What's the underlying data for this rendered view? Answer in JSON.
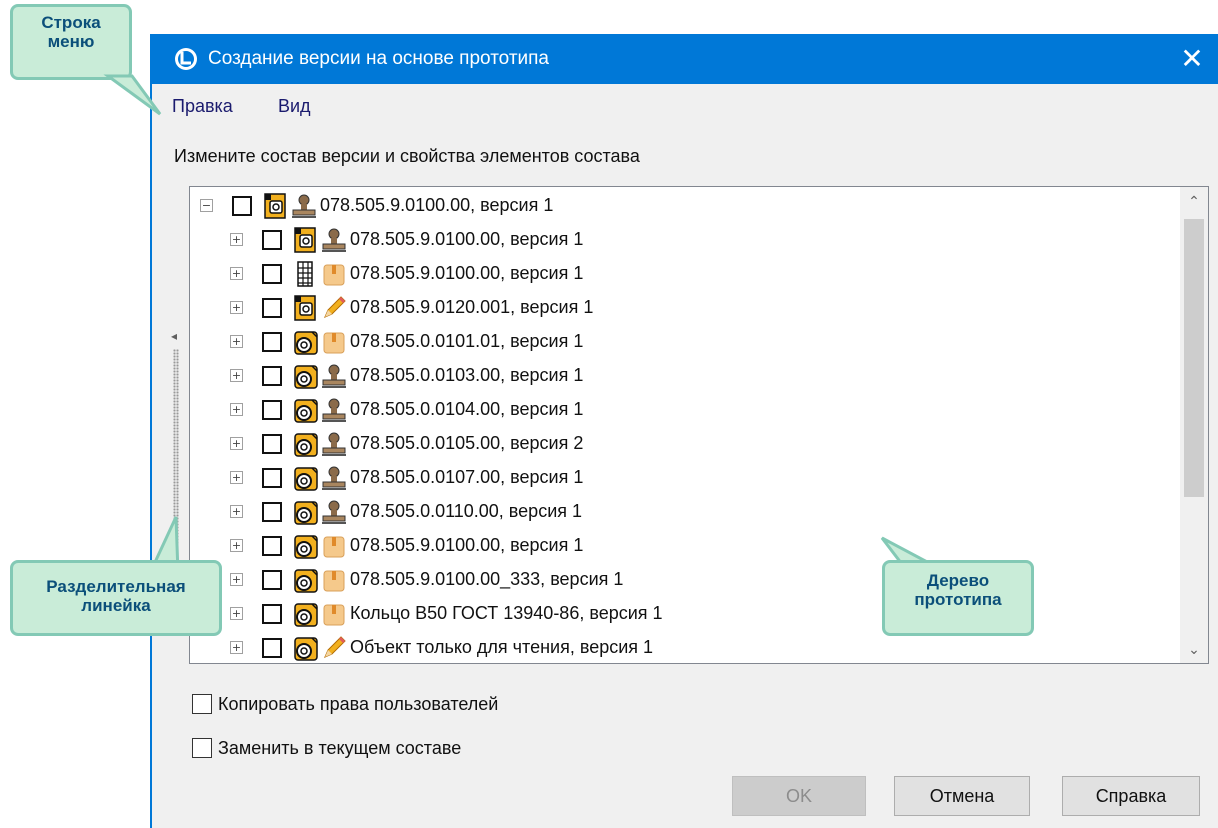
{
  "window": {
    "title": "Создание версии на основе прототипа",
    "close_glyph": "✕"
  },
  "menu": {
    "items": [
      {
        "label": "Правка"
      },
      {
        "label": "Вид"
      }
    ]
  },
  "instruction": "Измените состав версии и свойства элементов состава",
  "tree": {
    "root": {
      "label": "078.505.9.0100.00, версия 1",
      "expander": "⊟",
      "icon_left": "assembly-doc-icon",
      "icon_right": "stamp-icon"
    },
    "children": [
      {
        "label": "078.505.9.0100.00, версия 1",
        "icon_left": "assembly-doc-icon",
        "icon_right": "stamp-icon"
      },
      {
        "label": "078.505.9.0100.00, версия 1",
        "icon_left": "spec-table-icon",
        "icon_right": "package-icon"
      },
      {
        "label": "078.505.9.0120.001, версия 1",
        "icon_left": "assembly-doc-icon",
        "icon_right": "pencil-icon"
      },
      {
        "label": "078.505.0.0101.01, версия 1",
        "icon_left": "part-icon",
        "icon_right": "package-icon"
      },
      {
        "label": "078.505.0.0103.00, версия 1",
        "icon_left": "part-icon",
        "icon_right": "stamp-icon"
      },
      {
        "label": "078.505.0.0104.00, версия 1",
        "icon_left": "part-icon",
        "icon_right": "stamp-icon"
      },
      {
        "label": "078.505.0.0105.00, версия 2",
        "icon_left": "part-icon",
        "icon_right": "stamp-icon"
      },
      {
        "label": "078.505.0.0107.00, версия 1",
        "icon_left": "part-icon",
        "icon_right": "stamp-icon"
      },
      {
        "label": "078.505.0.0110.00, версия 1",
        "icon_left": "part-icon",
        "icon_right": "stamp-icon"
      },
      {
        "label": "078.505.9.0100.00, версия 1",
        "icon_left": "part-icon",
        "icon_right": "package-icon"
      },
      {
        "label": "078.505.9.0100.00_333, версия 1",
        "icon_left": "part-icon",
        "icon_right": "package-icon"
      },
      {
        "label": "Кольцо В50 ГОСТ 13940-86, версия 1",
        "icon_left": "part-icon",
        "icon_right": "package-icon"
      },
      {
        "label": "Объект только для чтения, версия 1",
        "icon_left": "part-icon",
        "icon_right": "pencil-icon"
      }
    ],
    "expander_collapsed": "⊞"
  },
  "options": {
    "copy_rights": {
      "label": "Копировать права пользователей",
      "checked": false
    },
    "replace_current": {
      "label": "Заменить в текущем составе",
      "checked": false
    }
  },
  "buttons": {
    "ok": "OK",
    "cancel": "Отмена",
    "help": "Справка"
  },
  "callouts": {
    "menu_bar": "Строка\nменю",
    "splitter": "Разделительная\nлинейка",
    "tree": "Дерево\nпрототипа"
  },
  "colors": {
    "titlebar": "#0078d7",
    "callout_fill": "#c9ecd8",
    "callout_border": "#83c9b5",
    "callout_text": "#0b4f7a"
  }
}
